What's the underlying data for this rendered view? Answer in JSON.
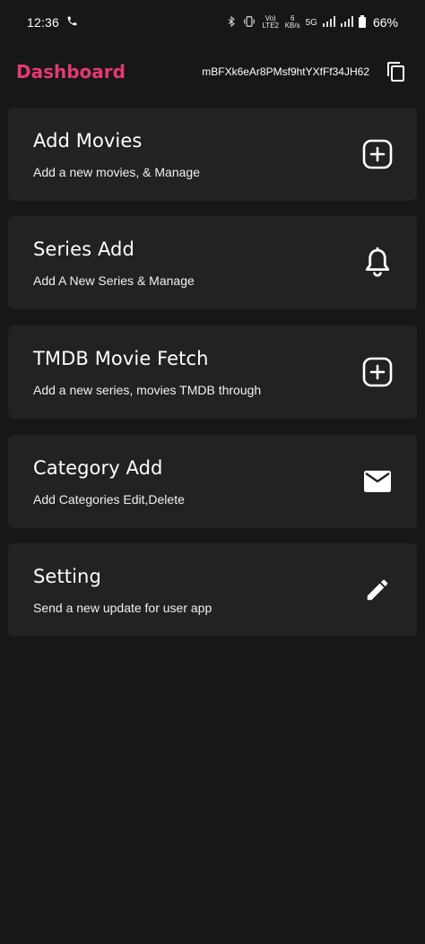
{
  "status_bar": {
    "time": "12:36",
    "network_top": "Vo) LTE2",
    "speed_value": "6",
    "speed_unit": "KB/s",
    "network_type": "5G",
    "battery": "66%"
  },
  "header": {
    "title": "Dashboard",
    "user_id": "mBFXk6eAr8PMsf9htYXfFf34JH62",
    "accent_color": "#e33a74"
  },
  "cards": [
    {
      "title": "Add Movies",
      "subtitle": "Add a new movies, & Manage",
      "icon": "add-box-icon"
    },
    {
      "title": "Series Add",
      "subtitle": "Add A New Series & Manage",
      "icon": "bell-icon"
    },
    {
      "title": "TMDB Movie Fetch",
      "subtitle": "Add a new series, movies TMDB through",
      "icon": "add-box-icon"
    },
    {
      "title": "Category Add",
      "subtitle": "Add Categories Edit,Delete",
      "icon": "mail-icon"
    },
    {
      "title": "Setting",
      "subtitle": "Send a new update for user app",
      "icon": "pencil-icon"
    }
  ]
}
